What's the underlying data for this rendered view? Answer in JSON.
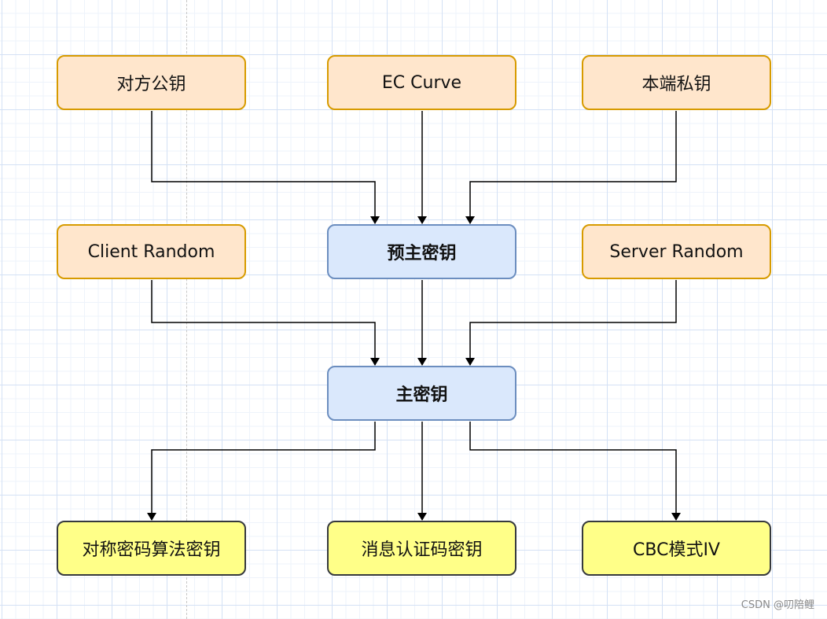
{
  "nodes": {
    "peer_public_key": "对方公钥",
    "ec_curve": "EC Curve",
    "local_private_key": "本端私钥",
    "client_random": "Client Random",
    "premaster_secret": "预主密钥",
    "server_random": "Server Random",
    "master_secret": "主密钥",
    "symmetric_key": "对称密码算法密钥",
    "mac_key": "消息认证码密钥",
    "cbc_iv": "CBC模式IV"
  },
  "colors": {
    "input_fill": "#ffe6cc",
    "input_stroke": "#d79b00",
    "secret_fill": "#dae8fc",
    "secret_stroke": "#6c8ebf",
    "output_fill": "#ffff88",
    "output_stroke": "#36393d"
  },
  "watermark": "CSDN @叨陪鲤"
}
